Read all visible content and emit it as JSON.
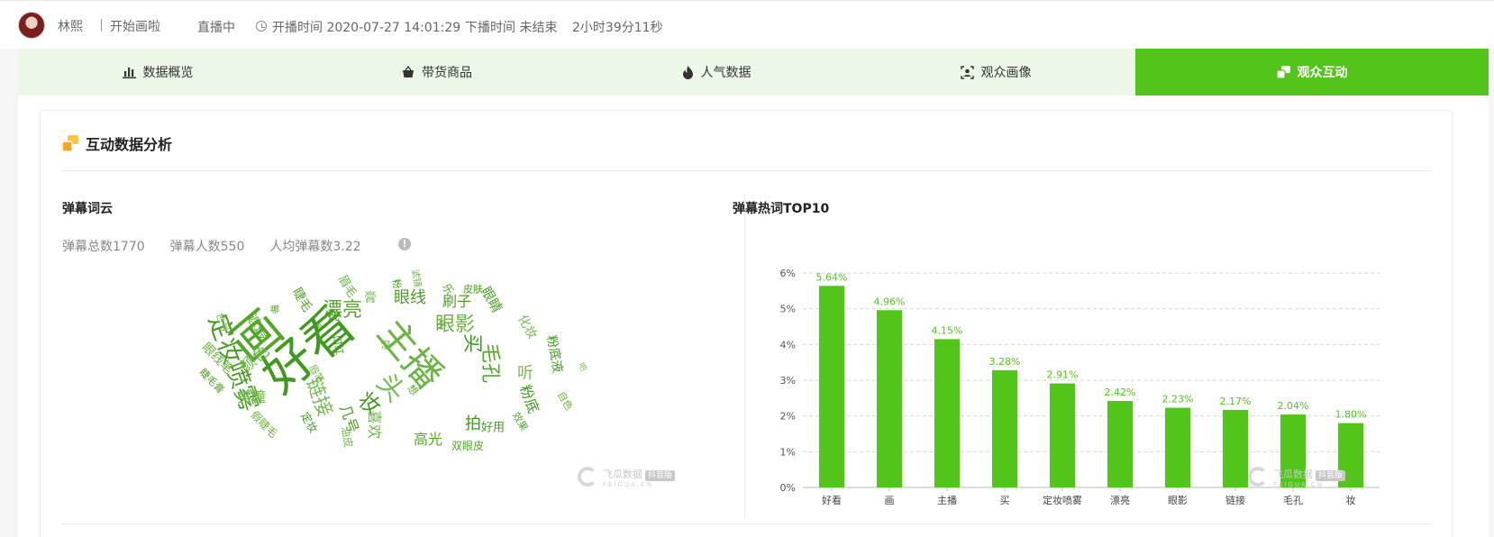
{
  "header": {
    "anchor_name": "林熙",
    "room_title": "开始画啦",
    "live_status": "直播中",
    "start_time": "开播时间 2020-07-27 14:01:29",
    "end_time": "下播时间 未结束",
    "duration": "2小时39分11秒"
  },
  "tabs": [
    {
      "label": "数据概览",
      "icon": "bar-chart-icon"
    },
    {
      "label": "带货商品",
      "icon": "shopping-basket-icon"
    },
    {
      "label": "人气数据",
      "icon": "flame-icon"
    },
    {
      "label": "观众画像",
      "icon": "user-frame-icon"
    },
    {
      "label": "观众互动",
      "icon": "interaction-icon",
      "active": true
    }
  ],
  "section": {
    "title": "互动数据分析",
    "icon": "interaction-icon",
    "accent": "#f5a623"
  },
  "wordcloud": {
    "title": "弹幕词云",
    "stats": [
      "弹幕总数1770",
      "弹幕人数550",
      "人均弹幕数3.22"
    ],
    "info_icon": "info-icon",
    "words": [
      {
        "t": "好看",
        "s": 56,
        "x": 168,
        "y": 86,
        "r": -40
      },
      {
        "t": "画",
        "s": 54,
        "x": 110,
        "y": 70,
        "r": -40
      },
      {
        "t": "主播",
        "s": 42,
        "x": 280,
        "y": 90,
        "r": 50
      },
      {
        "t": "定妆喷雾",
        "s": 28,
        "x": 84,
        "y": 100,
        "r": 70
      },
      {
        "t": "头",
        "s": 30,
        "x": 258,
        "y": 128,
        "r": 50
      },
      {
        "t": "妆",
        "s": 24,
        "x": 235,
        "y": 145,
        "r": 40
      },
      {
        "t": "漂亮",
        "s": 22,
        "x": 205,
        "y": 42,
        "r": 0
      },
      {
        "t": "眼影",
        "s": 22,
        "x": 330,
        "y": 58,
        "r": 0
      },
      {
        "t": "眼线",
        "s": 18,
        "x": 280,
        "y": 28,
        "r": 0
      },
      {
        "t": "链接",
        "s": 22,
        "x": 178,
        "y": 138,
        "r": 70
      },
      {
        "t": "买",
        "s": 22,
        "x": 348,
        "y": 78,
        "r": 90
      },
      {
        "t": "毛孔",
        "s": 22,
        "x": 368,
        "y": 100,
        "r": 90
      },
      {
        "t": "颜色",
        "s": 18,
        "x": 108,
        "y": 96,
        "r": -40
      },
      {
        "t": "刷子",
        "s": 16,
        "x": 332,
        "y": 32,
        "r": 0
      },
      {
        "t": "听",
        "s": 18,
        "x": 408,
        "y": 112,
        "r": 0
      },
      {
        "t": "拍",
        "s": 18,
        "x": 350,
        "y": 168,
        "r": 0
      },
      {
        "t": "高光",
        "s": 16,
        "x": 300,
        "y": 185,
        "r": 0
      },
      {
        "t": "喜欢",
        "s": 16,
        "x": 240,
        "y": 168,
        "r": 90
      },
      {
        "t": "几号",
        "s": 16,
        "x": 212,
        "y": 162,
        "r": 70
      },
      {
        "t": "美瞳",
        "s": 16,
        "x": 104,
        "y": 138,
        "r": 0
      },
      {
        "t": "粉底",
        "s": 16,
        "x": 412,
        "y": 140,
        "r": 70
      },
      {
        "t": "遮瑕",
        "s": 15,
        "x": 110,
        "y": 60,
        "r": 60
      },
      {
        "t": "眼线笔",
        "s": 14,
        "x": 66,
        "y": 95,
        "r": 45
      },
      {
        "t": "眼睛",
        "s": 15,
        "x": 370,
        "y": 30,
        "r": 60
      },
      {
        "t": "化妆",
        "s": 14,
        "x": 410,
        "y": 60,
        "r": 60
      },
      {
        "t": "粉底液",
        "s": 14,
        "x": 440,
        "y": 90,
        "r": 80
      },
      {
        "t": "睫毛",
        "s": 14,
        "x": 160,
        "y": 30,
        "r": 60
      },
      {
        "t": "眉毛",
        "s": 13,
        "x": 210,
        "y": 15,
        "r": 60
      },
      {
        "t": "说",
        "s": 14,
        "x": 195,
        "y": 48,
        "r": 0
      },
      {
        "t": "膏",
        "s": 14,
        "x": 236,
        "y": 28,
        "r": 0
      },
      {
        "t": "好用",
        "s": 13,
        "x": 372,
        "y": 172,
        "r": 0
      },
      {
        "t": "双眼皮",
        "s": 12,
        "x": 344,
        "y": 192,
        "r": 0
      },
      {
        "t": "假睫毛",
        "s": 12,
        "x": 118,
        "y": 168,
        "r": 45
      },
      {
        "t": "睫毛膏",
        "s": 11,
        "x": 60,
        "y": 120,
        "r": 45
      },
      {
        "t": "眉笔",
        "s": 11,
        "x": 176,
        "y": 112,
        "r": 60
      },
      {
        "t": "口红",
        "s": 11,
        "x": 200,
        "y": 80,
        "r": 80
      },
      {
        "t": "效果",
        "s": 11,
        "x": 402,
        "y": 165,
        "r": 60
      },
      {
        "t": "自色",
        "s": 11,
        "x": 452,
        "y": 142,
        "r": 60
      },
      {
        "t": "皮肤",
        "s": 11,
        "x": 350,
        "y": 18,
        "r": 0
      },
      {
        "t": "色号",
        "s": 11,
        "x": 72,
        "y": 55,
        "r": 70
      },
      {
        "t": "粉",
        "s": 11,
        "x": 265,
        "y": 12,
        "r": 80
      },
      {
        "t": "乐",
        "s": 12,
        "x": 322,
        "y": 18,
        "r": 60
      },
      {
        "t": "滤镜",
        "s": 10,
        "x": 286,
        "y": 6,
        "r": 80
      },
      {
        "t": "哪",
        "s": 10,
        "x": 130,
        "y": 42,
        "r": 0
      },
      {
        "t": "油皮",
        "s": 12,
        "x": 210,
        "y": 182,
        "r": 80
      },
      {
        "t": "定妆",
        "s": 12,
        "x": 168,
        "y": 166,
        "r": 60
      },
      {
        "t": "想",
        "s": 11,
        "x": 283,
        "y": 130,
        "r": 50
      },
      {
        "t": "湿",
        "s": 11,
        "x": 253,
        "y": 80,
        "r": 0
      },
      {
        "t": "化",
        "s": 10,
        "x": 314,
        "y": 58,
        "r": 50
      },
      {
        "t": "吧",
        "s": 9,
        "x": 470,
        "y": 105,
        "r": 60
      },
      {
        "t": "画",
        "s": 10,
        "x": 176,
        "y": 60,
        "r": 50
      }
    ]
  },
  "watermark": {
    "name": "飞瓜数据",
    "tag": "抖音版",
    "sub": "FEIGUA.CN"
  },
  "chart_data": {
    "type": "bar",
    "title": "弹幕热词TOP10",
    "categories": [
      "好看",
      "画",
      "主播",
      "买",
      "定妆喷雾",
      "漂亮",
      "眼影",
      "链接",
      "毛孔",
      "妆"
    ],
    "values": [
      5.64,
      4.96,
      4.15,
      3.28,
      2.91,
      2.42,
      2.23,
      2.17,
      2.04,
      1.8
    ],
    "data_labels": [
      "5.64%",
      "4.96%",
      "4.15%",
      "3.28%",
      "2.91%",
      "2.42%",
      "2.23%",
      "2.17%",
      "2.04%",
      "1.80%"
    ],
    "y_ticks": [
      "0%",
      "1%",
      "2%",
      "3%",
      "4%",
      "5%",
      "6%"
    ],
    "ylim": [
      0,
      6
    ],
    "grid": true,
    "bar_color": "#52c41a",
    "label_color": "#52c41a"
  }
}
